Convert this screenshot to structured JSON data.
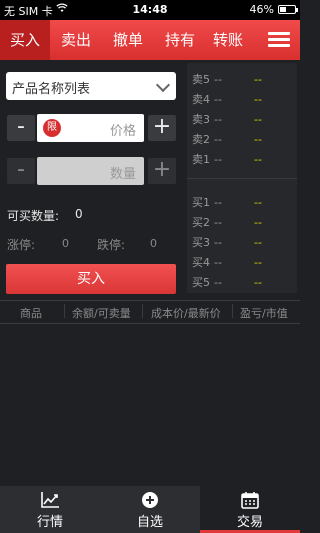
{
  "status": {
    "carrier": "无 SIM 卡",
    "time": "14:48",
    "battery": "46%",
    "battery_level": 0.46
  },
  "nav": {
    "tabs": [
      "买入",
      "卖出",
      "撤单",
      "持有",
      "转账"
    ],
    "active_index": 0
  },
  "form": {
    "product_select": "产品名称列表",
    "limit_badge": "限",
    "price_placeholder": "价格",
    "quantity_placeholder": "数量",
    "minus": "-",
    "plus": "+",
    "buyable_label": "可买数量:",
    "buyable_value": "0",
    "limit_up_label": "涨停:",
    "limit_up_value": "0",
    "limit_down_label": "跌停:",
    "limit_down_value": "0",
    "buy_button": "买入"
  },
  "order_book": {
    "asks": [
      {
        "label": "卖5",
        "price": "--",
        "volume": "--"
      },
      {
        "label": "卖4",
        "price": "--",
        "volume": "--"
      },
      {
        "label": "卖3",
        "price": "--",
        "volume": "--"
      },
      {
        "label": "卖2",
        "price": "--",
        "volume": "--"
      },
      {
        "label": "卖1",
        "price": "--",
        "volume": "--"
      }
    ],
    "bids": [
      {
        "label": "买1",
        "price": "--",
        "volume": "--"
      },
      {
        "label": "买2",
        "price": "--",
        "volume": "--"
      },
      {
        "label": "买3",
        "price": "--",
        "volume": "--"
      },
      {
        "label": "买4",
        "price": "--",
        "volume": "--"
      },
      {
        "label": "买5",
        "price": "--",
        "volume": "--"
      }
    ]
  },
  "holdings_header": [
    "商品",
    "余额/可卖量",
    "成本价/最新价",
    "盈亏/市值"
  ],
  "tabbar": {
    "items": [
      {
        "label": "行情",
        "icon": "chart-icon"
      },
      {
        "label": "自选",
        "icon": "plus-circle-icon"
      },
      {
        "label": "交易",
        "icon": "calendar-icon"
      }
    ],
    "active_index": 2
  },
  "colors": {
    "accent": "#e23a3a",
    "volume_text": "#d9d900"
  }
}
